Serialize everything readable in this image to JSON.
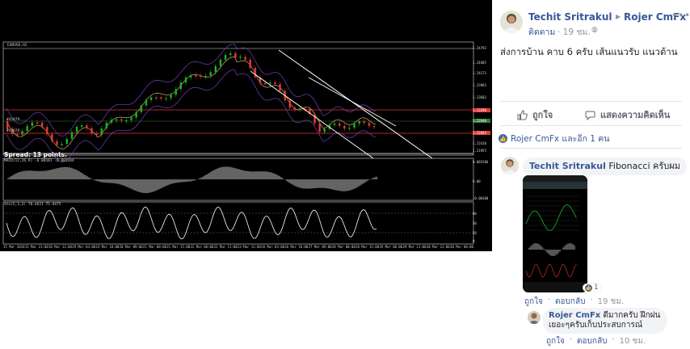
{
  "chart": {
    "symbol": "EURUSD,H1",
    "ma_label_1": "#42079...",
    "ma_label_2": "#42079...",
    "spread_text": "Spread: 13 points.",
    "macd_label": "MACD(12,26,9) -0.00101 -0.001444",
    "stoch_label": "Sto(5,3,3) 78.4621 75.9475",
    "price_tags": [
      "1.24793",
      "1.24405",
      "1.24173",
      "1.23983",
      "1.23603",
      "1.23290",
      "1.22940",
      "1.22603",
      "1.22410",
      "1.21955",
      "1.21850"
    ],
    "macd_tags": [
      "0.001586",
      "0.00",
      "-0.00308"
    ],
    "stoch_tags": [
      "80",
      "50",
      "20",
      "0"
    ],
    "dates": [
      "15 Mar 2018",
      "15 Mar 21:00",
      "16 Mar 12:00",
      "19 Mar 03:00",
      "19 Mar 18:00",
      "20 Mar 09:00",
      "21 Mar 00:00",
      "21 Mar 15:00",
      "22 Mar 06:00",
      "22 Mar 21:00",
      "23 Mar 12:00",
      "26 Mar 03:00",
      "26 Mar 18:00",
      "27 Mar 09:00",
      "28 Mar 00:00",
      "28 Mar 15:00",
      "29 Mar 06:00",
      "29 Mar 21:00",
      "30 Mar 12:00",
      "30 Mar 00:00"
    ],
    "colors": {
      "bull": "#19b324",
      "bear": "#e53935",
      "bands": "#7b3fc4",
      "trend": "#ffffff",
      "macd": "#c9c9c9",
      "stoch": "#ffffff"
    }
  },
  "post": {
    "author": "Techit Sritrakul",
    "page": "Rojer CmFx",
    "follow": "ติดตาม",
    "time": "· 19 ชม. ·",
    "caption": "ส่งการบ้าน คาบ 6 ครับ เส้นแนวรับ แนวต้าน",
    "like_label": "ถูกใจ",
    "comment_label": "แสดงความคิดเห็น",
    "reactions": "Rojer CmFx และอีก 1 คน"
  },
  "comments": [
    {
      "author": "Techit Sritrakul",
      "text": "Fibonacci ครับผม",
      "image_likes": "1",
      "like": "ถูกใจ",
      "reply": "ตอบกลับ",
      "time": "19 ชม."
    },
    {
      "author": "Rojer CmFx",
      "text": "ดีมากครับ ฝึกฝนเยอะๆครับเก็บประสบการณ์",
      "like": "ถูกใจ",
      "reply": "ตอบกลับ",
      "time": "10 ชม."
    }
  ]
}
